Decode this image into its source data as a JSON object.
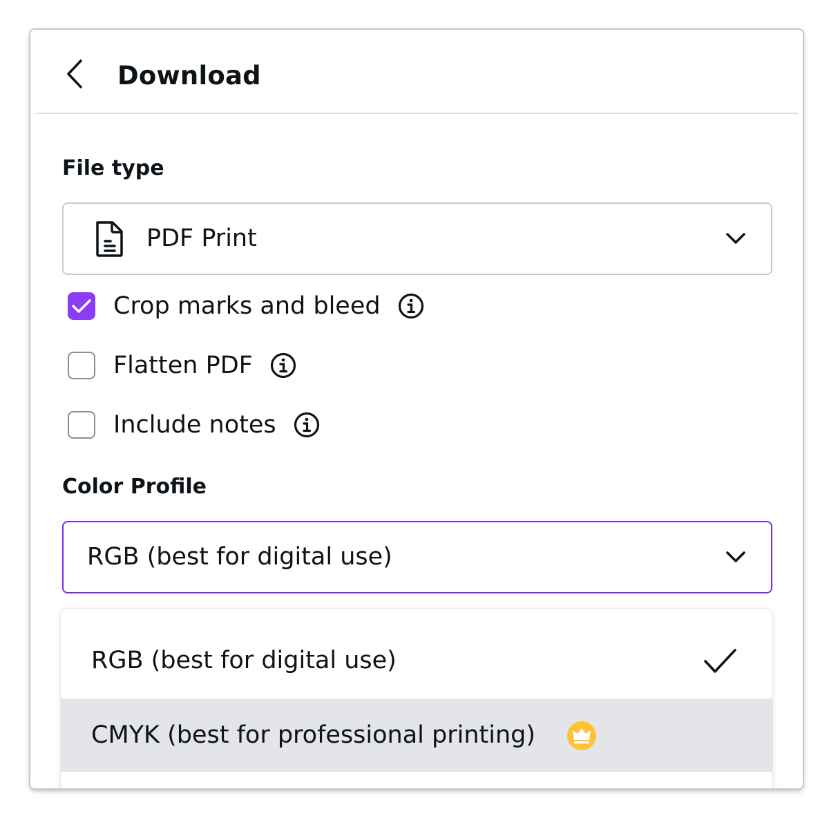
{
  "header": {
    "title": "Download",
    "back_icon": "chevron-left-icon"
  },
  "file_type": {
    "label": "File type",
    "selected": "PDF Print",
    "icon": "document-icon"
  },
  "options": [
    {
      "label": "Crop marks and bleed",
      "checked": true
    },
    {
      "label": "Flatten PDF",
      "checked": false
    },
    {
      "label": "Include notes",
      "checked": false
    }
  ],
  "color_profile": {
    "label": "Color Profile",
    "selected": "RGB (best for digital use)",
    "menu": [
      {
        "label": "RGB (best for digital use)",
        "selected": true
      },
      {
        "label": "CMYK (best for professional printing)",
        "selected": false,
        "premium": true
      }
    ]
  },
  "colors": {
    "accent": "#8b3cf7",
    "focus_border": "#7d2ae8",
    "hover_bg": "#e3e5e9",
    "crown_bg": "#ffc233"
  }
}
